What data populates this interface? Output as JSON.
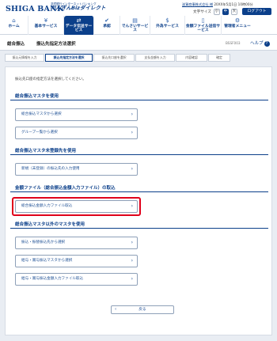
{
  "header": {
    "bank_logo": "SHIGA BANK",
    "brand_sub1": "滋賀銀行インターネットバンキング",
    "brand_sub2": "たんぎんBizダイレクト",
    "user_line": "滋賀商事株式会社 様",
    "user_time": "20XX年5月1日 10時00分",
    "font_size_label": "文字サイズ",
    "font_size_small": "小",
    "font_size_medium": "中",
    "font_size_large": "大",
    "logout": "ログアウト"
  },
  "nav": [
    {
      "label": "ホーム",
      "icon": "home-icon",
      "glyph": "⌂"
    },
    {
      "label": "基本サービス",
      "icon": "yen-icon",
      "glyph": "¥"
    },
    {
      "label": "データ伝送サービス",
      "icon": "transfer-icon",
      "glyph": "⇄"
    },
    {
      "label": "承認",
      "icon": "approval-icon",
      "glyph": "✔"
    },
    {
      "label": "でんさいサービス",
      "icon": "densai-icon",
      "glyph": "▤"
    },
    {
      "label": "外為サービス",
      "icon": "forex-icon",
      "glyph": "$"
    },
    {
      "label": "金額ファイル送信サービス",
      "icon": "file-icon",
      "glyph": "▯"
    },
    {
      "label": "管理者メニュー",
      "icon": "admin-icon",
      "glyph": "⚙"
    }
  ],
  "title": {
    "section": "総合振込",
    "page": "振込先指定方法選択",
    "screen_code": "BSSF003",
    "help": "ヘルプ",
    "help_glyph": "?"
  },
  "steps": [
    "振込元情報を入力",
    "振込先指定方法を選択",
    "振込先口座を選択",
    "支払金額を入力",
    "内容確認",
    "確定"
  ],
  "instruction": "振込先口座の指定方法を選択してください。",
  "sections": [
    {
      "title": "総合振込マスタを使用",
      "options": [
        "総合振込マスタから選択",
        "グループ一覧から選択"
      ]
    },
    {
      "title": "総合振込マスタ未登録先を使用",
      "options": [
        "新規（未登録）の振込先の入力使用"
      ]
    },
    {
      "title": "金額ファイル（総合振込金額入力ファイル）の取込",
      "options": [
        "総合振込金額入力ファイル取込"
      ]
    },
    {
      "title": "総合振込マスタ以外のマスタを使用",
      "options": [
        "振込・振替振込先から選択",
        "給与・賞与振込マスタから選択",
        "給与・賞与振込金額入力ファイル取込"
      ]
    }
  ],
  "back_button": "戻る",
  "back_glyph": "‹",
  "colors": {
    "brand": "#0b3f8a",
    "highlight": "#e0001b"
  }
}
